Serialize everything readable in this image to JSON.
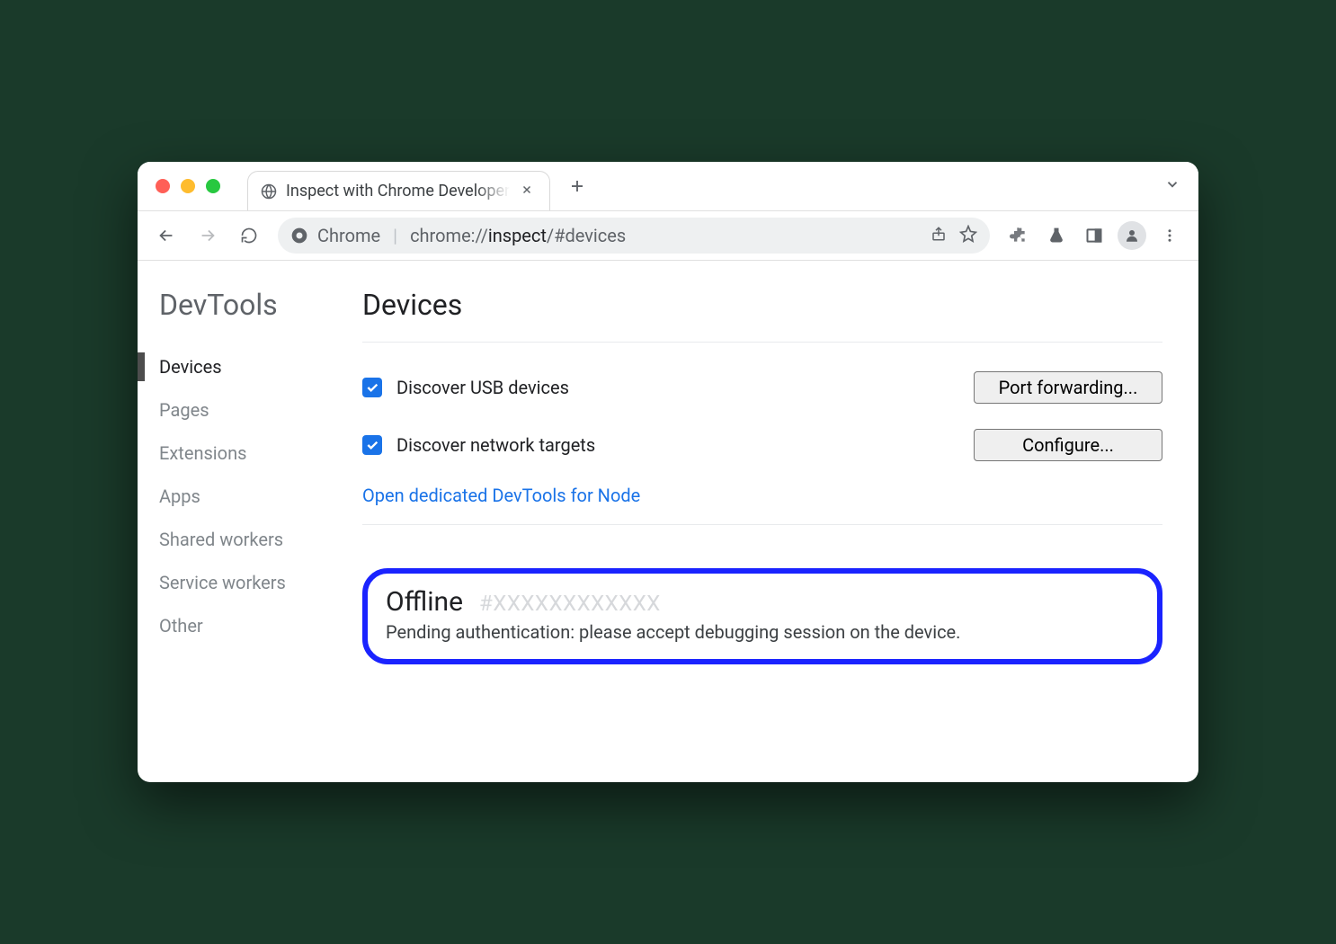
{
  "window": {
    "tab_title": "Inspect with Chrome Developer",
    "dropdown_visible": true
  },
  "toolbar": {
    "origin_label": "Chrome",
    "url_dim": "chrome://",
    "url_strong": "inspect",
    "url_tail": "/#devices"
  },
  "page": {
    "app_title": "DevTools",
    "heading": "Devices",
    "sidebar": [
      {
        "label": "Devices",
        "active": true
      },
      {
        "label": "Pages",
        "active": false
      },
      {
        "label": "Extensions",
        "active": false
      },
      {
        "label": "Apps",
        "active": false
      },
      {
        "label": "Shared workers",
        "active": false
      },
      {
        "label": "Service workers",
        "active": false
      },
      {
        "label": "Other",
        "active": false
      }
    ],
    "usb": {
      "label": "Discover USB devices",
      "checked": true,
      "button": "Port forwarding..."
    },
    "network": {
      "label": "Discover network targets",
      "checked": true,
      "button": "Configure..."
    },
    "node_link": "Open dedicated DevTools for Node",
    "device": {
      "status": "Offline",
      "hash": "#XXXXXXXXXXXX",
      "message": "Pending authentication: please accept debugging session on the device."
    }
  }
}
